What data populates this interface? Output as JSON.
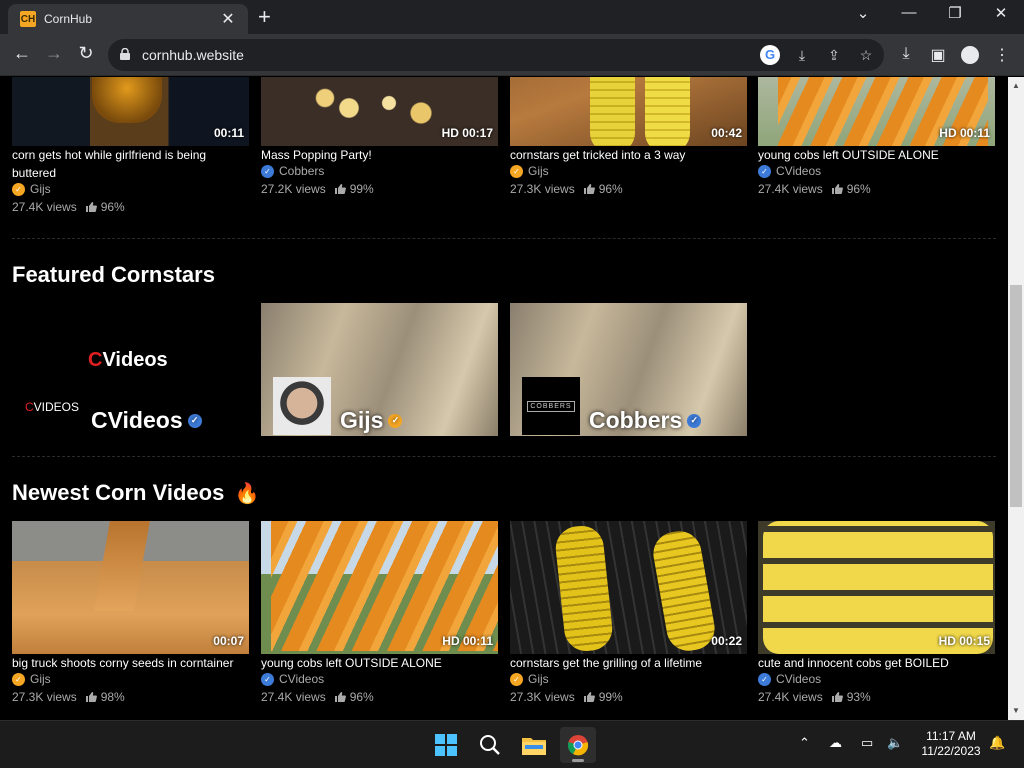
{
  "browser": {
    "tab_title": "CornHub",
    "favicon_text": "CH",
    "url": "cornhub.website",
    "omnibox_icons": [
      "google-lens-icon",
      "install-icon",
      "share-icon",
      "bookmark-star-icon"
    ],
    "toolbar_icons": [
      "downloads-icon",
      "side-panel-icon",
      "profile-icon",
      "menu-icon"
    ]
  },
  "top_videos": [
    {
      "title": "corn gets hot while girlfriend is being buttered",
      "channel": "Gijs",
      "verified_color": "orange",
      "views": "27.4K views",
      "rating": "96%",
      "duration": "00:11"
    },
    {
      "title": "Mass Popping Party!",
      "channel": "Cobbers",
      "verified_color": "blue",
      "views": "27.2K views",
      "rating": "99%",
      "duration": "HD 00:17"
    },
    {
      "title": "cornstars get tricked into a 3 way",
      "channel": "Gijs",
      "verified_color": "orange",
      "views": "27.3K views",
      "rating": "96%",
      "duration": "00:42"
    },
    {
      "title": "young cobs left OUTSIDE ALONE",
      "channel": "CVideos",
      "verified_color": "blue",
      "views": "27.4K views",
      "rating": "96%",
      "duration": "HD 00:11"
    }
  ],
  "featured": {
    "heading": "Featured Cornstars",
    "stars": [
      {
        "name": "CVideos",
        "logo_big": "CVideos",
        "logo_small": "CVIDEOS",
        "verified_color": "blue"
      },
      {
        "name": "Gijs",
        "verified_color": "orange"
      },
      {
        "name": "Cobbers",
        "logo_text": "COBBERS",
        "verified_color": "blue"
      }
    ]
  },
  "newest": {
    "heading": "Newest Corn Videos",
    "emoji": "🔥",
    "videos": [
      {
        "title": "big truck shoots corny seeds in corntainer",
        "channel": "Gijs",
        "verified_color": "orange",
        "views": "27.3K views",
        "rating": "98%",
        "duration": "00:07"
      },
      {
        "title": "young cobs left OUTSIDE ALONE",
        "channel": "CVideos",
        "verified_color": "blue",
        "views": "27.4K views",
        "rating": "96%",
        "duration": "HD 00:11"
      },
      {
        "title": "cornstars get the grilling of a lifetime",
        "channel": "Gijs",
        "verified_color": "orange",
        "views": "27.3K views",
        "rating": "99%",
        "duration": "00:22"
      },
      {
        "title": "cute and innocent cobs get BOILED",
        "channel": "CVideos",
        "verified_color": "blue",
        "views": "27.4K views",
        "rating": "93%",
        "duration": "HD 00:15"
      }
    ]
  },
  "taskbar": {
    "time": "11:17 AM",
    "date": "11/22/2023",
    "apps": [
      "windows-start-icon",
      "search-icon",
      "file-explorer-icon",
      "chrome-icon"
    ]
  },
  "colors": {
    "orange_badge": "#f5a623",
    "blue_badge": "#3d7bd8",
    "cvideos_red": "#e02020"
  }
}
